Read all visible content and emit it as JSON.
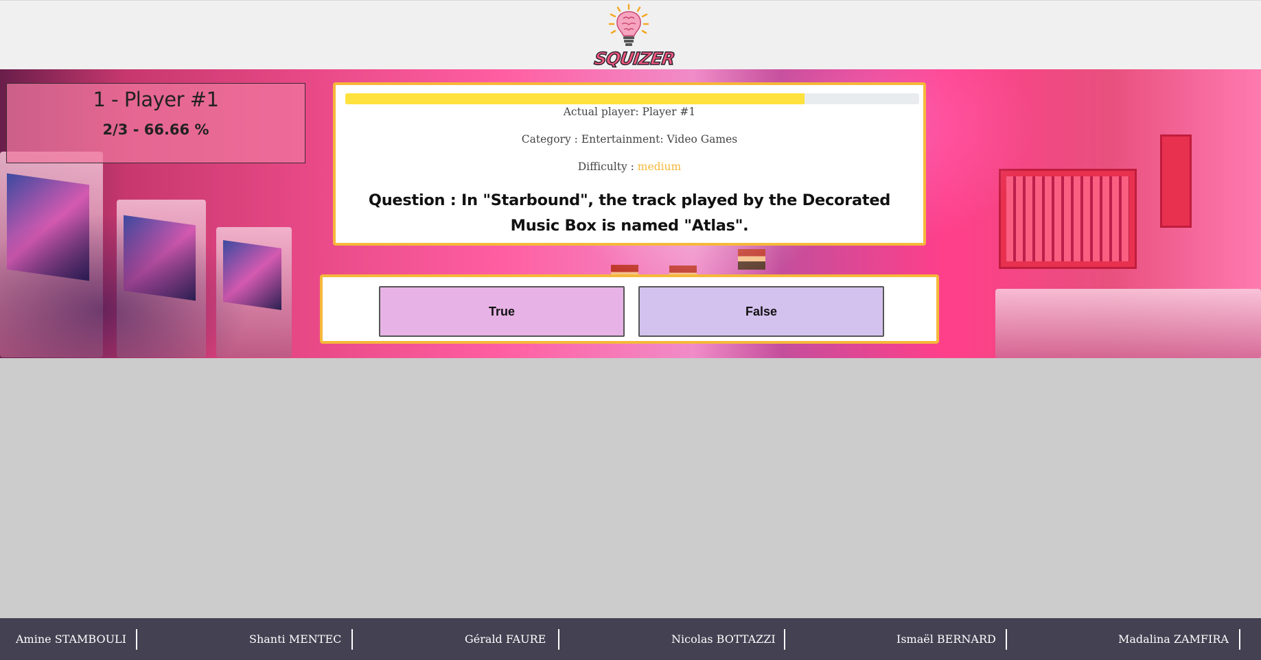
{
  "header": {
    "logo_text": "SQUIZER",
    "logo_icon": "lightbulb-brain-icon"
  },
  "scoreboard": {
    "title": "1 - Player #1",
    "score_line": "2/3 - 66.66 %"
  },
  "question_card": {
    "progress_fraction": 0.8,
    "actual_player": "Actual player: Player #1",
    "category": "Category : Entertainment: Video Games",
    "difficulty_label": "Difficulty : ",
    "difficulty_value": "medium",
    "question": "Question : In \"Starbound\", the track played by the Decorated Music Box is named \"Atlas\"."
  },
  "answers": {
    "true_label": "True",
    "false_label": "False"
  },
  "footer": {
    "credits": [
      "Amine STAMBOULI",
      "Shanti MENTEC",
      "Gérald FAURE",
      "Nicolas BOTTAZZI",
      "Ismaël BERNARD",
      "Madalina ZAMFIRA"
    ]
  },
  "colors": {
    "accent_border": "#f5b83a",
    "progress_fill": "#ffe23e",
    "true_button": "#e7b3e6",
    "false_button": "#d4c2ee",
    "footer_bg": "#444152",
    "logo_pink": "#f3587d"
  }
}
